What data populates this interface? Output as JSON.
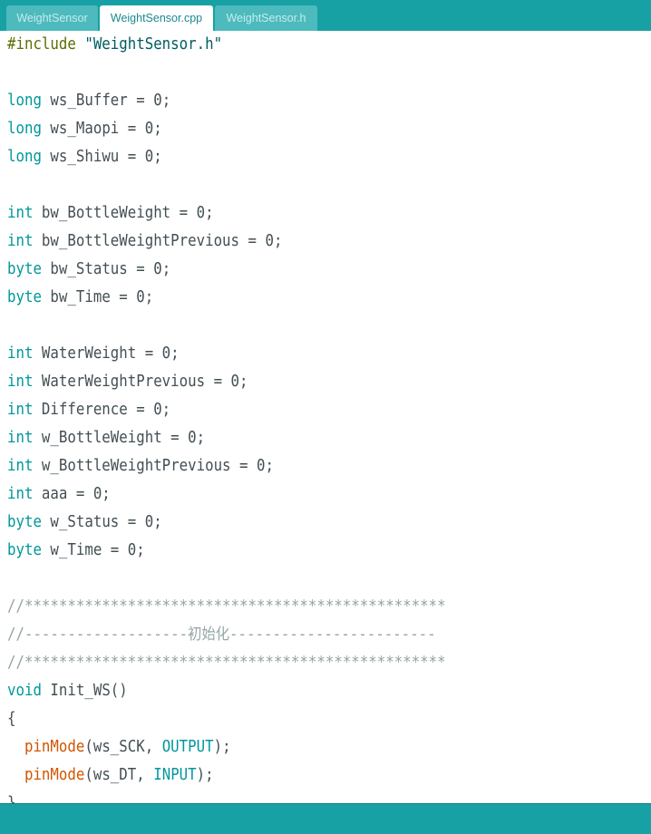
{
  "tabs": [
    {
      "label": "WeightSensor",
      "active": false
    },
    {
      "label": "WeightSensor.cpp",
      "active": true
    },
    {
      "label": "WeightSensor.h",
      "active": false
    }
  ],
  "colors": {
    "toolbar": "#17a1a5",
    "tab_inactive": "#4dbabd",
    "keyword_type": "#00979c",
    "function": "#d35400",
    "preprocessor": "#5e6d03",
    "comment": "#95a5a6",
    "text": "#434f54"
  },
  "code_lines": [
    [
      {
        "t": "#include ",
        "c": "preproc"
      },
      {
        "t": "\"WeightSensor.h\"",
        "c": "string"
      }
    ],
    [],
    [
      {
        "t": "long",
        "c": "type"
      },
      {
        "t": " ws_Buffer = 0;",
        "c": "plain"
      }
    ],
    [
      {
        "t": "long",
        "c": "type"
      },
      {
        "t": " ws_Maopi = 0;",
        "c": "plain"
      }
    ],
    [
      {
        "t": "long",
        "c": "type"
      },
      {
        "t": " ws_Shiwu = 0;",
        "c": "plain"
      }
    ],
    [],
    [
      {
        "t": "int",
        "c": "type"
      },
      {
        "t": " bw_BottleWeight = 0;",
        "c": "plain"
      }
    ],
    [
      {
        "t": "int",
        "c": "type"
      },
      {
        "t": " bw_BottleWeightPrevious = 0;",
        "c": "plain"
      }
    ],
    [
      {
        "t": "byte",
        "c": "type"
      },
      {
        "t": " bw_Status = 0;",
        "c": "plain"
      }
    ],
    [
      {
        "t": "byte",
        "c": "type"
      },
      {
        "t": " bw_Time = 0;",
        "c": "plain"
      }
    ],
    [],
    [
      {
        "t": "int",
        "c": "type"
      },
      {
        "t": " WaterWeight = 0;",
        "c": "plain"
      }
    ],
    [
      {
        "t": "int",
        "c": "type"
      },
      {
        "t": " WaterWeightPrevious = 0;",
        "c": "plain"
      }
    ],
    [
      {
        "t": "int",
        "c": "type"
      },
      {
        "t": " Difference = 0;",
        "c": "plain"
      }
    ],
    [
      {
        "t": "int",
        "c": "type"
      },
      {
        "t": " w_BottleWeight = 0;",
        "c": "plain"
      }
    ],
    [
      {
        "t": "int",
        "c": "type"
      },
      {
        "t": " w_BottleWeightPrevious = 0;",
        "c": "plain"
      }
    ],
    [
      {
        "t": "int",
        "c": "type"
      },
      {
        "t": " aaa = 0;",
        "c": "plain"
      }
    ],
    [
      {
        "t": "byte",
        "c": "type"
      },
      {
        "t": " w_Status = 0;",
        "c": "plain"
      }
    ],
    [
      {
        "t": "byte",
        "c": "type"
      },
      {
        "t": " w_Time = 0;",
        "c": "plain"
      }
    ],
    [],
    [
      {
        "t": "//*************************************************",
        "c": "comment"
      }
    ],
    [
      {
        "t": "//-------------------",
        "c": "comment"
      },
      {
        "t": "初始化",
        "c": "comment cjk"
      },
      {
        "t": "------------------------",
        "c": "comment"
      }
    ],
    [
      {
        "t": "//*************************************************",
        "c": "comment"
      }
    ],
    [
      {
        "t": "void",
        "c": "type"
      },
      {
        "t": " Init_WS()",
        "c": "plain"
      }
    ],
    [
      {
        "t": "{",
        "c": "plain"
      }
    ],
    [
      {
        "t": "  ",
        "c": "plain"
      },
      {
        "t": "pinMode",
        "c": "func"
      },
      {
        "t": "(ws_SCK, ",
        "c": "plain"
      },
      {
        "t": "OUTPUT",
        "c": "const"
      },
      {
        "t": ");",
        "c": "plain"
      }
    ],
    [
      {
        "t": "  ",
        "c": "plain"
      },
      {
        "t": "pinMode",
        "c": "func"
      },
      {
        "t": "(ws_DT, ",
        "c": "plain"
      },
      {
        "t": "INPUT",
        "c": "const"
      },
      {
        "t": ");",
        "c": "plain"
      }
    ],
    [
      {
        "t": "}",
        "c": "plain"
      }
    ]
  ]
}
